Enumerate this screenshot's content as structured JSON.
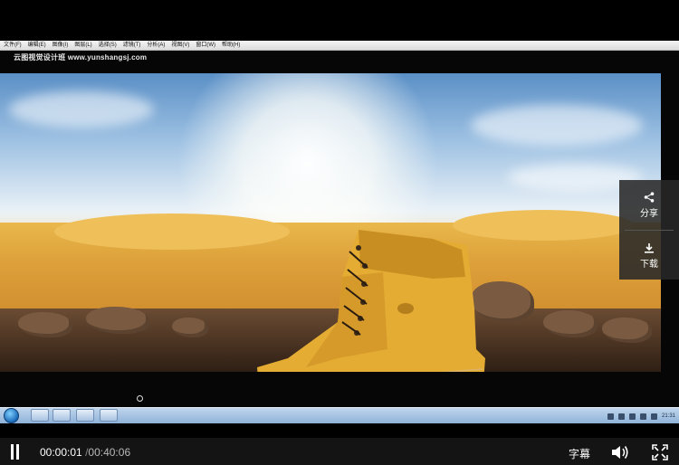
{
  "menubar": {
    "items": [
      "文件(F)",
      "编辑(E)",
      "图像(I)",
      "图层(L)",
      "选择(S)",
      "滤镜(T)",
      "分析(A)",
      "视图(V)",
      "窗口(W)",
      "帮助(H)"
    ]
  },
  "watermark": "云图视觉设计班 www.yunshangsj.com",
  "side_panel": {
    "share_label": "分享",
    "download_label": "下载",
    "share_icon": "share-icon",
    "download_icon": "download-icon"
  },
  "taskbar": {
    "clock": "21:31"
  },
  "player": {
    "current_time": "00:00:01",
    "separator": "/",
    "duration": "00:40:06",
    "subtitle_label": "字幕",
    "playing_state": "paused-icon"
  },
  "colors": {
    "control_bar": "#141414",
    "panel": "#282828",
    "boot": "#e2a92c"
  }
}
